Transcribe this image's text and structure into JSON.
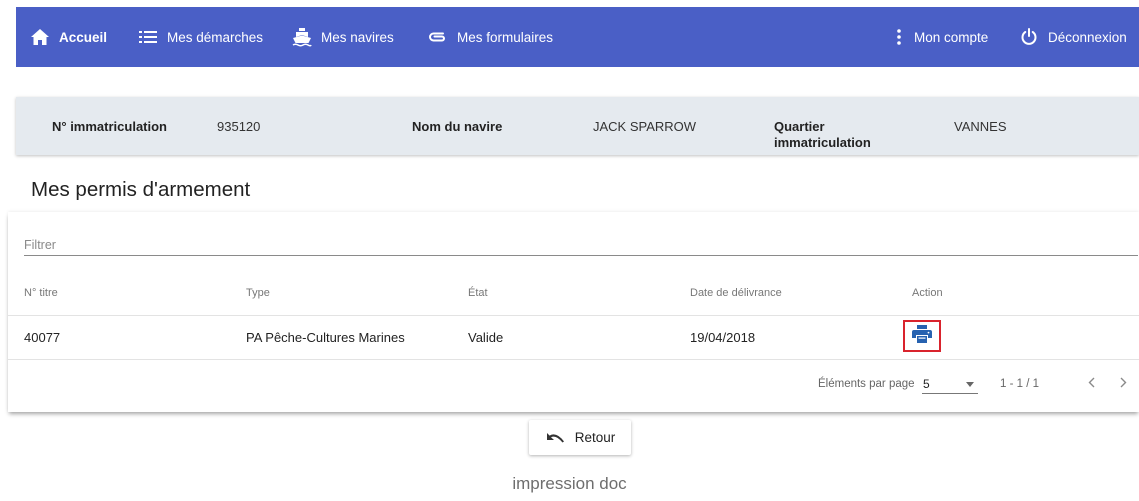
{
  "nav": {
    "accueil": "Accueil",
    "demarches": "Mes démarches",
    "navires": "Mes navires",
    "formulaires": "Mes formulaires",
    "compte": "Mon compte",
    "deconnexion": "Déconnexion"
  },
  "vessel": {
    "immat_label": "N° immatriculation",
    "immat_value": "935120",
    "name_label": "Nom du navire",
    "name_value": "JACK SPARROW",
    "quartier_label": "Quartier immatriculation",
    "quartier_value": "VANNES"
  },
  "page_title": "Mes permis d'armement",
  "filter": {
    "placeholder": "Filtrer",
    "value": ""
  },
  "table": {
    "headers": [
      "N° titre",
      "Type",
      "État",
      "Date de délivrance",
      "Action"
    ],
    "rows": [
      {
        "titre": "40077",
        "type": "PA Pêche-Cultures Marines",
        "etat": "Valide",
        "date": "19/04/2018"
      }
    ]
  },
  "paginator": {
    "label": "Éléments par page",
    "page_size": "5",
    "range": "1 - 1 / 1"
  },
  "retour_label": "Retour",
  "caption": "impression doc",
  "colors": {
    "nav_bg": "#4a5fc6",
    "print_icon": "#2762b0",
    "highlight": "#d9232d",
    "infobar_bg": "#e5eaef"
  },
  "icons": {
    "accueil": "home-icon",
    "demarches": "list-icon",
    "navires": "ship-icon",
    "formulaires": "attachment-icon",
    "compte": "more-vert-icon",
    "deconnexion": "power-icon",
    "action": "print-icon",
    "retour": "undo-icon",
    "prev": "chevron-left-icon",
    "next": "chevron-right-icon"
  }
}
